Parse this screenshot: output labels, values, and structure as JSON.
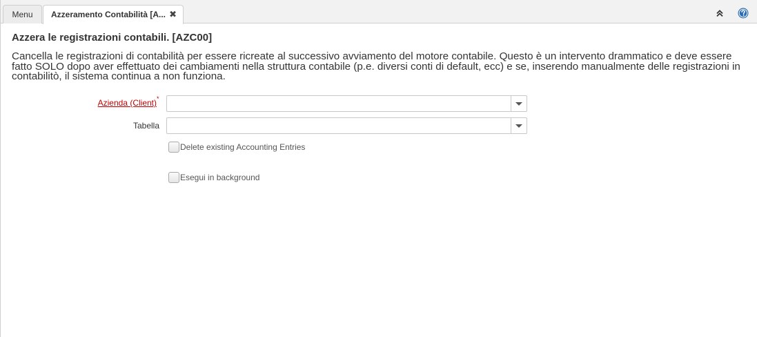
{
  "tabs": {
    "menu_label": "Menu",
    "active_label": "Azzeramento Contabilità [A...",
    "close_glyph": "✖"
  },
  "toolbar": {
    "collapse_icon": "double-chevron-up-icon",
    "help_icon": "help-circle-icon",
    "accent_color": "#2a6db5"
  },
  "page": {
    "title": "Azzera le registrazioni contabili. [AZC00]",
    "description": "Cancella le registrazioni di contabilità per essere ricreate al successivo avviamento del motore contabile. Questo è un intervento drammatico e deve essere fatto SOLO dopo aver effettuato dei cambiamenti nella struttura contabile (p.e. diversi conti di default, ecc) e se, inserendo manualmente delle registrazioni in contabilitò, il sistema continua a non funziona."
  },
  "form": {
    "client_label": "Azienda (Client)",
    "client_required_mark": "*",
    "client_value": "",
    "table_label": "Tabella",
    "table_value": "",
    "delete_entries_label": "Delete existing Accounting Entries",
    "background_label": "Esegui in background",
    "required_color": "#c00000"
  }
}
